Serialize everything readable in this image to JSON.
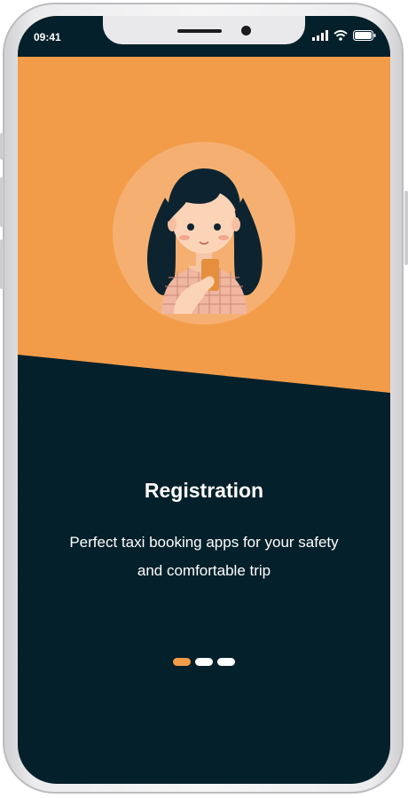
{
  "status_bar": {
    "time": "09:41"
  },
  "onboarding": {
    "title": "Registration",
    "subtitle": "Perfect taxi booking apps for your safety and comfortable trip",
    "illustration": "girl-holding-phone-illustration"
  },
  "pager": {
    "count": 3,
    "active_index": 0
  },
  "colors": {
    "accent": "#F29C4A",
    "dark": "#04202A",
    "white": "#FFFFFF"
  }
}
